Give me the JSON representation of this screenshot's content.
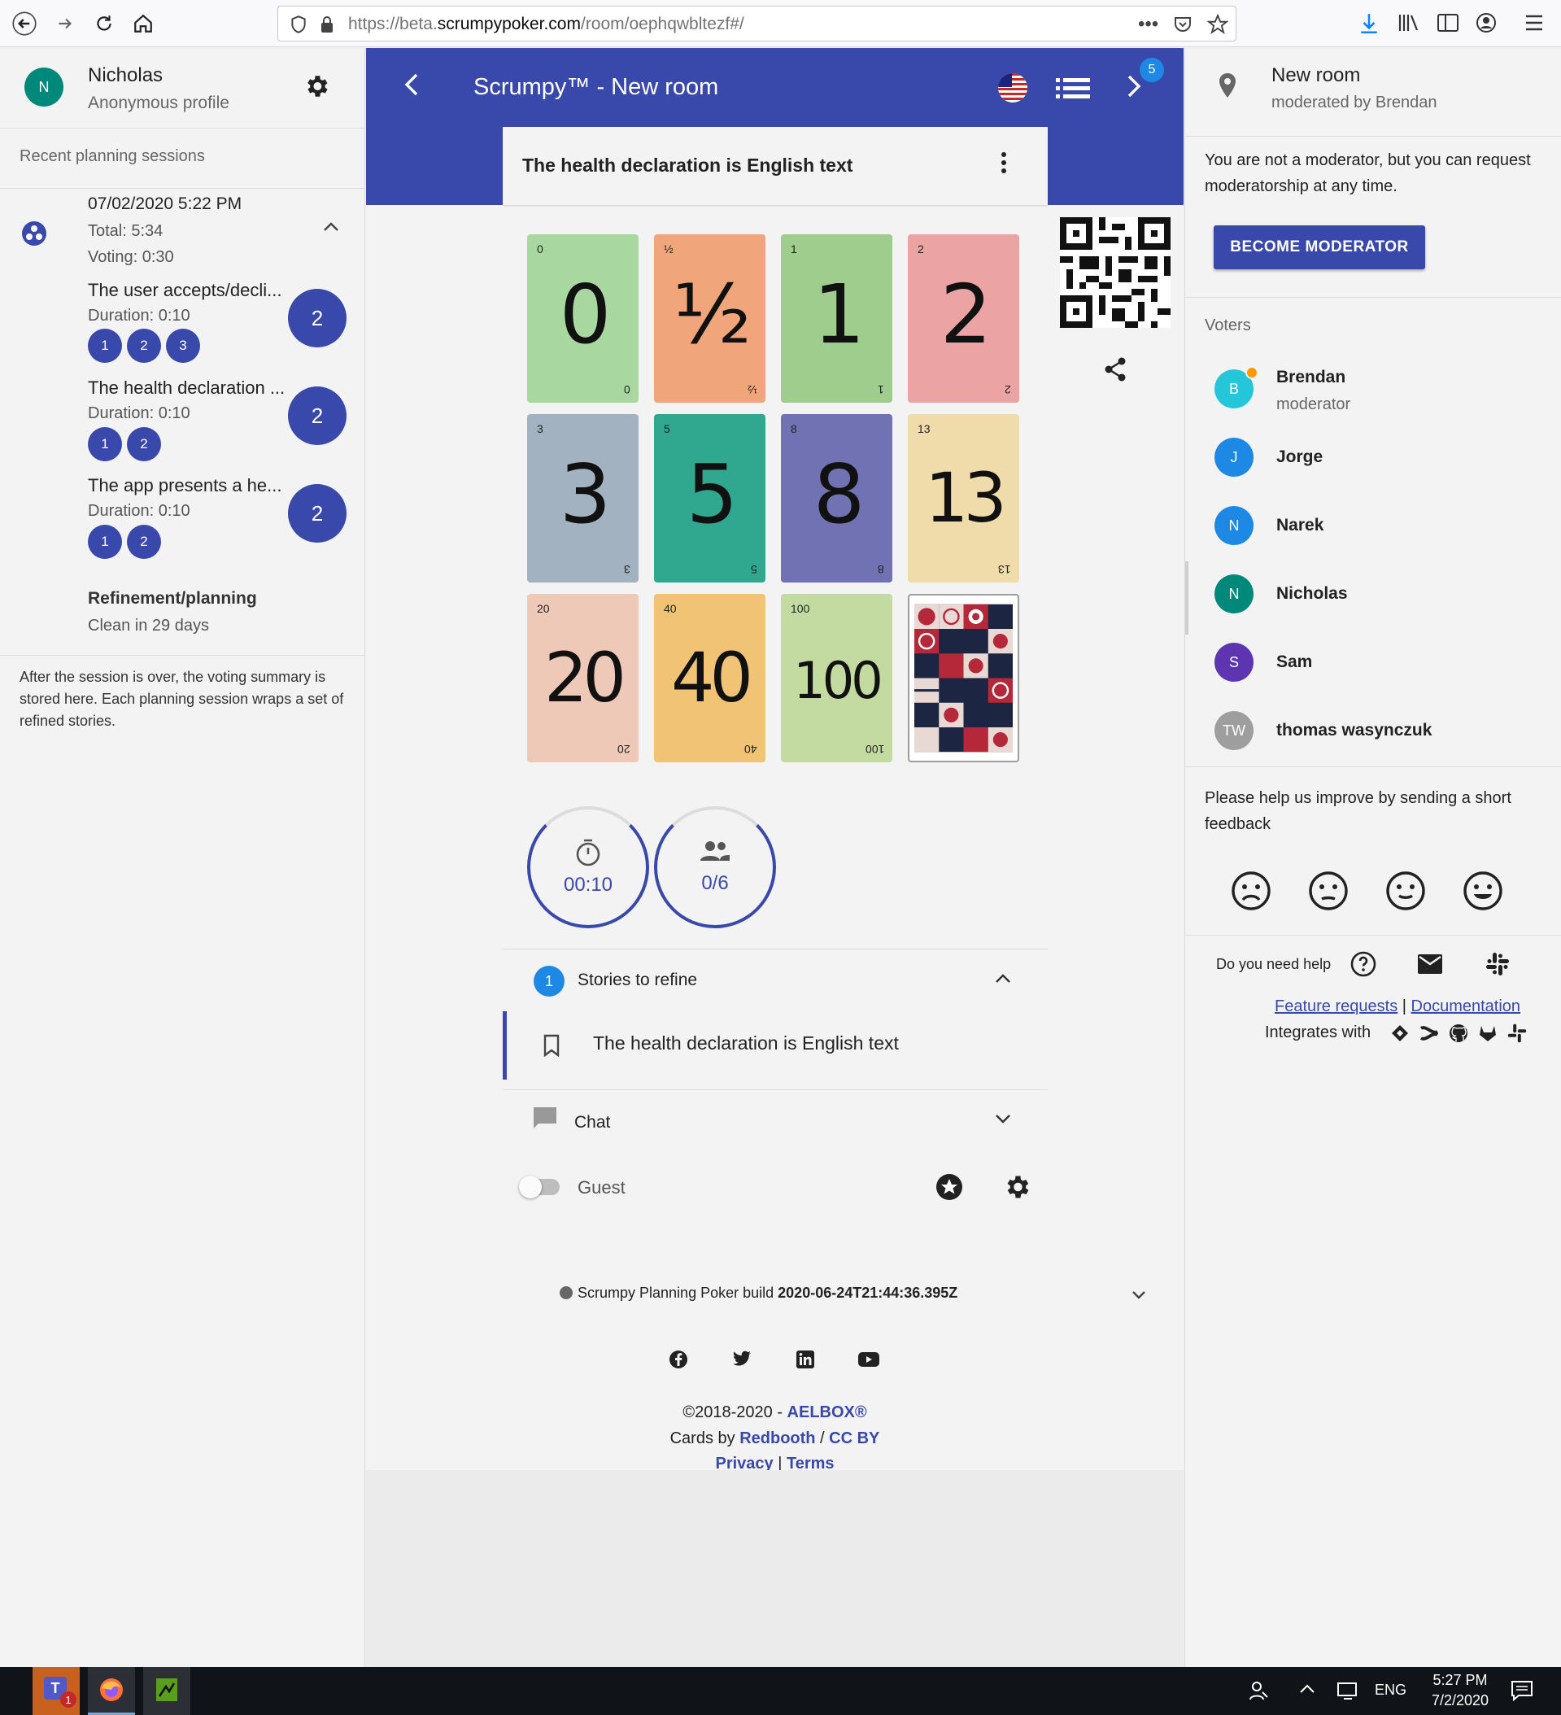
{
  "browser": {
    "url_prefix": "https://beta.",
    "url_domain": "scrumpypoker.com",
    "url_path": "/room/oephqwbltezf#/"
  },
  "profile": {
    "initial": "N",
    "name": "Nicholas",
    "subtitle": "Anonymous profile"
  },
  "sessions": {
    "heading": "Recent planning sessions",
    "date": "07/02/2020 5:22 PM",
    "total": "Total: 5:34",
    "voting": "Voting: 0:30",
    "items": [
      {
        "title": "The user accepts/decli...",
        "duration": "Duration: 0:10",
        "votes": [
          "1",
          "2",
          "3"
        ],
        "result": "2"
      },
      {
        "title": "The health declaration ...",
        "duration": "Duration: 0:10",
        "votes": [
          "1",
          "2"
        ],
        "result": "2"
      },
      {
        "title": "The app presents a he...",
        "duration": "Duration: 0:10",
        "votes": [
          "1",
          "2"
        ],
        "result": "2"
      }
    ],
    "team": "Refinement/planning",
    "clean": "Clean in 29 days",
    "footnote": "After the session is over, the voting summary is stored here. Each planning session wraps a set of refined stories."
  },
  "room": {
    "title": "Scrumpy™ - New room",
    "notification_count": "5",
    "current_story": "The health declaration is English text"
  },
  "cards": [
    {
      "label": "0",
      "corner": "0",
      "bg": "#a8d8a0"
    },
    {
      "label": "½",
      "corner": "½",
      "bg": "#f1a57a"
    },
    {
      "label": "1",
      "corner": "1",
      "bg": "#9fcd8e"
    },
    {
      "label": "2",
      "corner": "2",
      "bg": "#eba4a3"
    },
    {
      "label": "3",
      "corner": "3",
      "bg": "#a3b2c0"
    },
    {
      "label": "5",
      "corner": "5",
      "bg": "#2fa88f"
    },
    {
      "label": "8",
      "corner": "8",
      "bg": "#7072b3"
    },
    {
      "label": "13",
      "corner": "13",
      "bg": "#efdcaa"
    },
    {
      "label": "20",
      "corner": "20",
      "bg": "#efc9b7"
    },
    {
      "label": "40",
      "corner": "40",
      "bg": "#f0c474"
    },
    {
      "label": "100",
      "corner": "100",
      "bg": "#c3dba0"
    }
  ],
  "timer": {
    "value": "00:10"
  },
  "participants": {
    "value": "0/6"
  },
  "stories": {
    "count": "1",
    "heading": "Stories to refine",
    "items": [
      "The health declaration is English text"
    ]
  },
  "chat": {
    "label": "Chat"
  },
  "guest": {
    "label": "Guest"
  },
  "footer": {
    "build_label": "Scrumpy Planning Poker build",
    "build": "2020-06-24T21:44:36.395Z",
    "copyright": "©2018-2020 - ",
    "company": "AELBOX®",
    "cards_by": "Cards by ",
    "redbooth": "Redbooth",
    "sep": " / ",
    "license": "CC BY",
    "privacy": "Privacy",
    "bar": " | ",
    "terms": "Terms"
  },
  "right": {
    "room_name": "New room",
    "moderated_by": "moderated by Brendan",
    "moderator_note": "You are not a moderator, but you can request moderatorship at any time.",
    "become_moderator": "BECOME MODERATOR",
    "voters_heading": "Voters",
    "voters": [
      {
        "initial": "B",
        "name": "Brendan",
        "role": "moderator",
        "color": "#26c6da"
      },
      {
        "initial": "J",
        "name": "Jorge",
        "role": "",
        "color": "#1e88e5"
      },
      {
        "initial": "N",
        "name": "Narek",
        "role": "",
        "color": "#1e88e5"
      },
      {
        "initial": "N",
        "name": "Nicholas",
        "role": "",
        "color": "#00897b"
      },
      {
        "initial": "S",
        "name": "Sam",
        "role": "",
        "color": "#5e35b1"
      },
      {
        "initial": "TW",
        "name": "thomas wasynczuk",
        "role": "",
        "color": "#9e9e9e"
      }
    ],
    "feedback": "Please help us improve by sending a short feedback",
    "help": "Do you need help",
    "feature_requests": "Feature requests",
    "documentation": "Documentation",
    "integrates": "Integrates with"
  },
  "taskbar": {
    "lang": "ENG",
    "time": "5:27 PM",
    "date": "7/2/2020",
    "teams_badge": "1"
  }
}
